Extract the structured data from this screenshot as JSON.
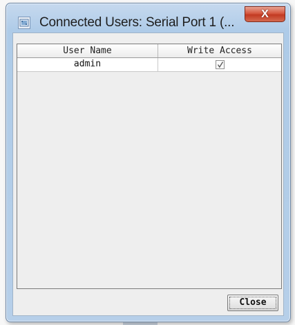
{
  "window": {
    "title": "Connected Users: Serial Port 1 (...",
    "icon": "serial-port-icon",
    "close_glyph": "X"
  },
  "table": {
    "columns": [
      "User Name",
      "Write Access"
    ],
    "rows": [
      {
        "user_name": "admin",
        "write_access": true
      }
    ]
  },
  "footer": {
    "close_label": "Close"
  },
  "colors": {
    "titlebar": "#b6cfe9",
    "close_x": "#c23a22",
    "panel": "#eeeeee"
  }
}
